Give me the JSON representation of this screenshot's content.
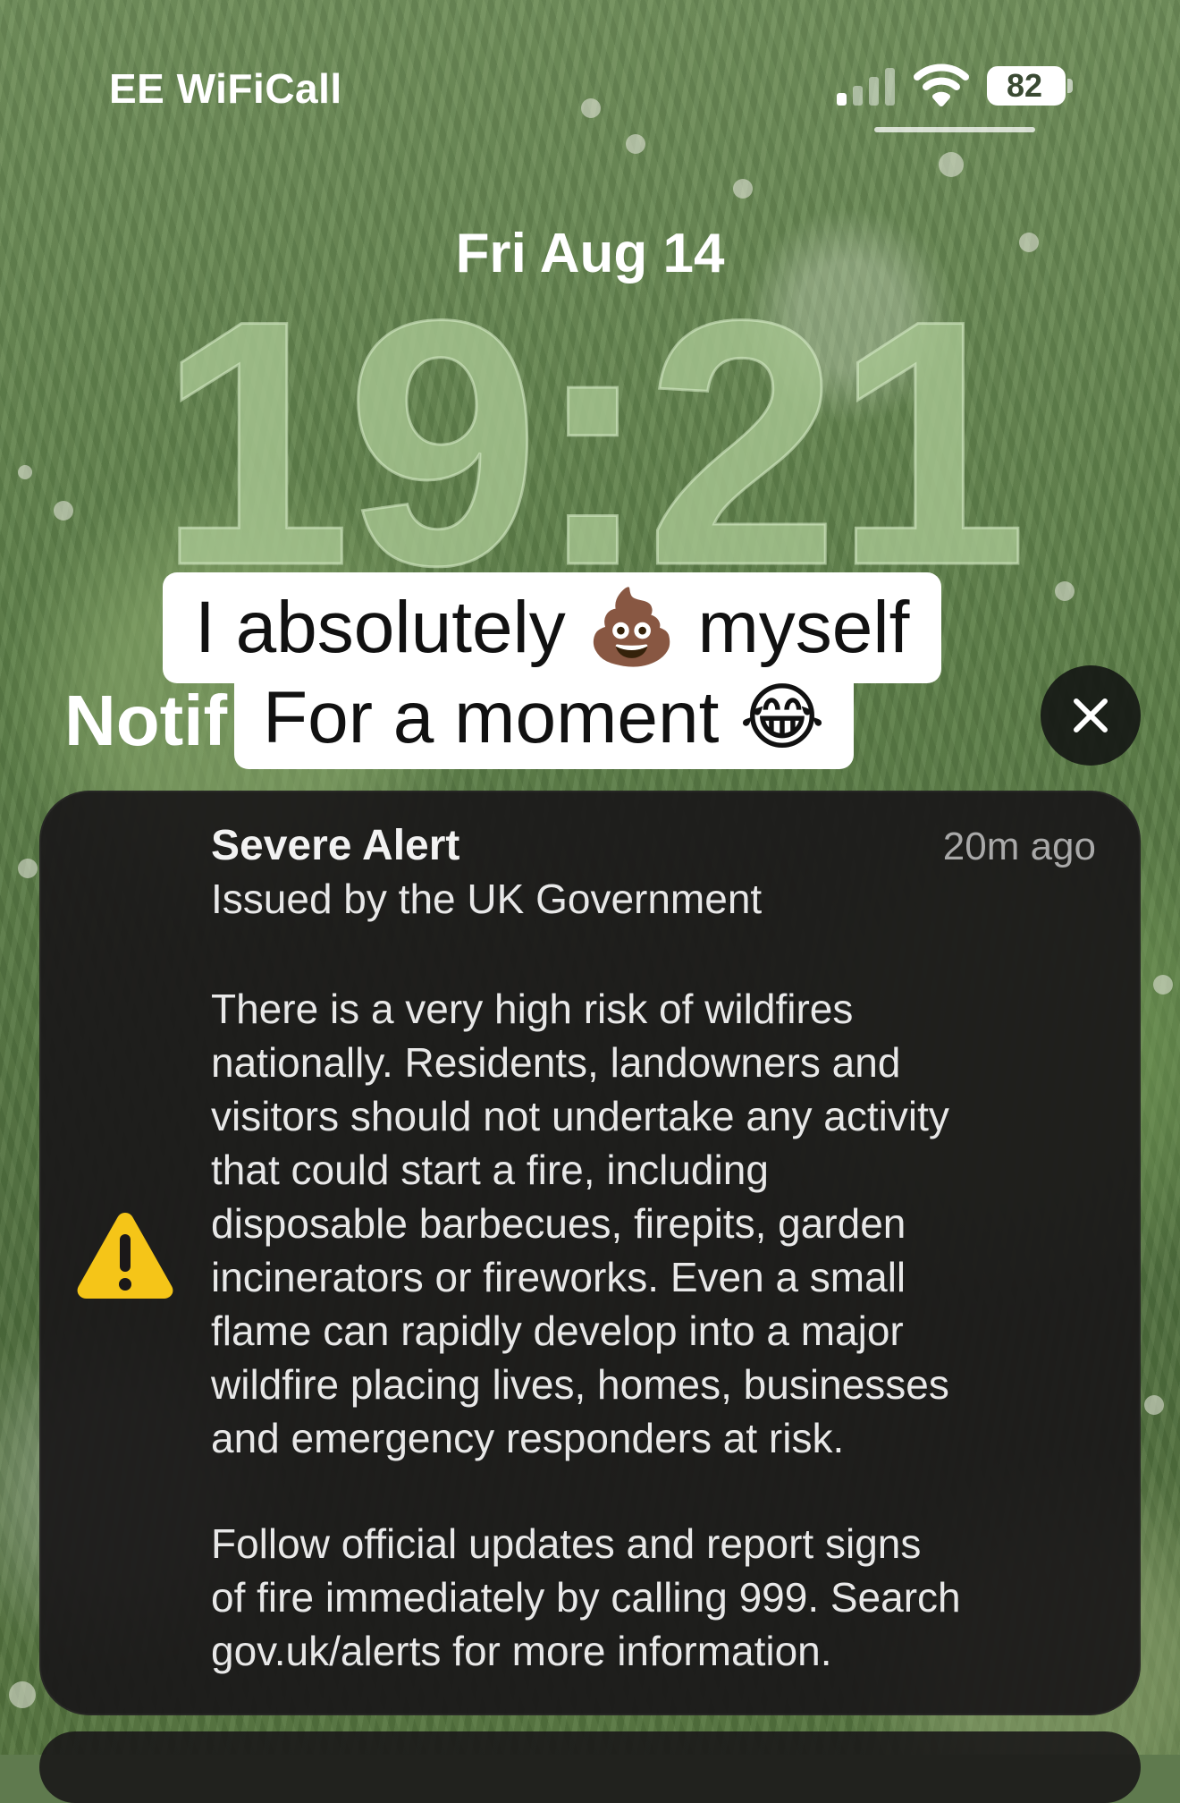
{
  "status_bar": {
    "carrier": "EE WiFiCall",
    "battery_level": "82",
    "signal_bars_active": 1,
    "signal_bars_total": 4,
    "signal_icon": "cellular-signal-icon",
    "wifi_icon": "wifi-icon"
  },
  "lock_screen": {
    "date": "Fri Aug 14",
    "time": "19:21",
    "notifications_heading": "Notif"
  },
  "captions": {
    "line1": "I absolutely 💩 myself",
    "line2": "For a moment 😂"
  },
  "clear_button": {
    "icon": "close-icon"
  },
  "alert": {
    "icon": "warning-triangle-icon",
    "icon_color": "#F5C518",
    "title": "Severe Alert",
    "time": "20m ago",
    "issuer": "Issued by the UK Government",
    "body_paragraph_1": "There is a very high risk of wildfires\nnationally. Residents, landowners and\nvisitors should not undertake any activity\nthat could start a fire, including\ndisposable barbecues, firepits, garden\nincinerators or fireworks. Even a small\nflame can rapidly develop into a major\nwildfire placing lives, homes, businesses\nand emergency responders at risk.",
    "body_paragraph_2": "Follow official updates and report signs\nof fire immediately by calling 999. Search\ngov.uk/alerts for more information."
  }
}
